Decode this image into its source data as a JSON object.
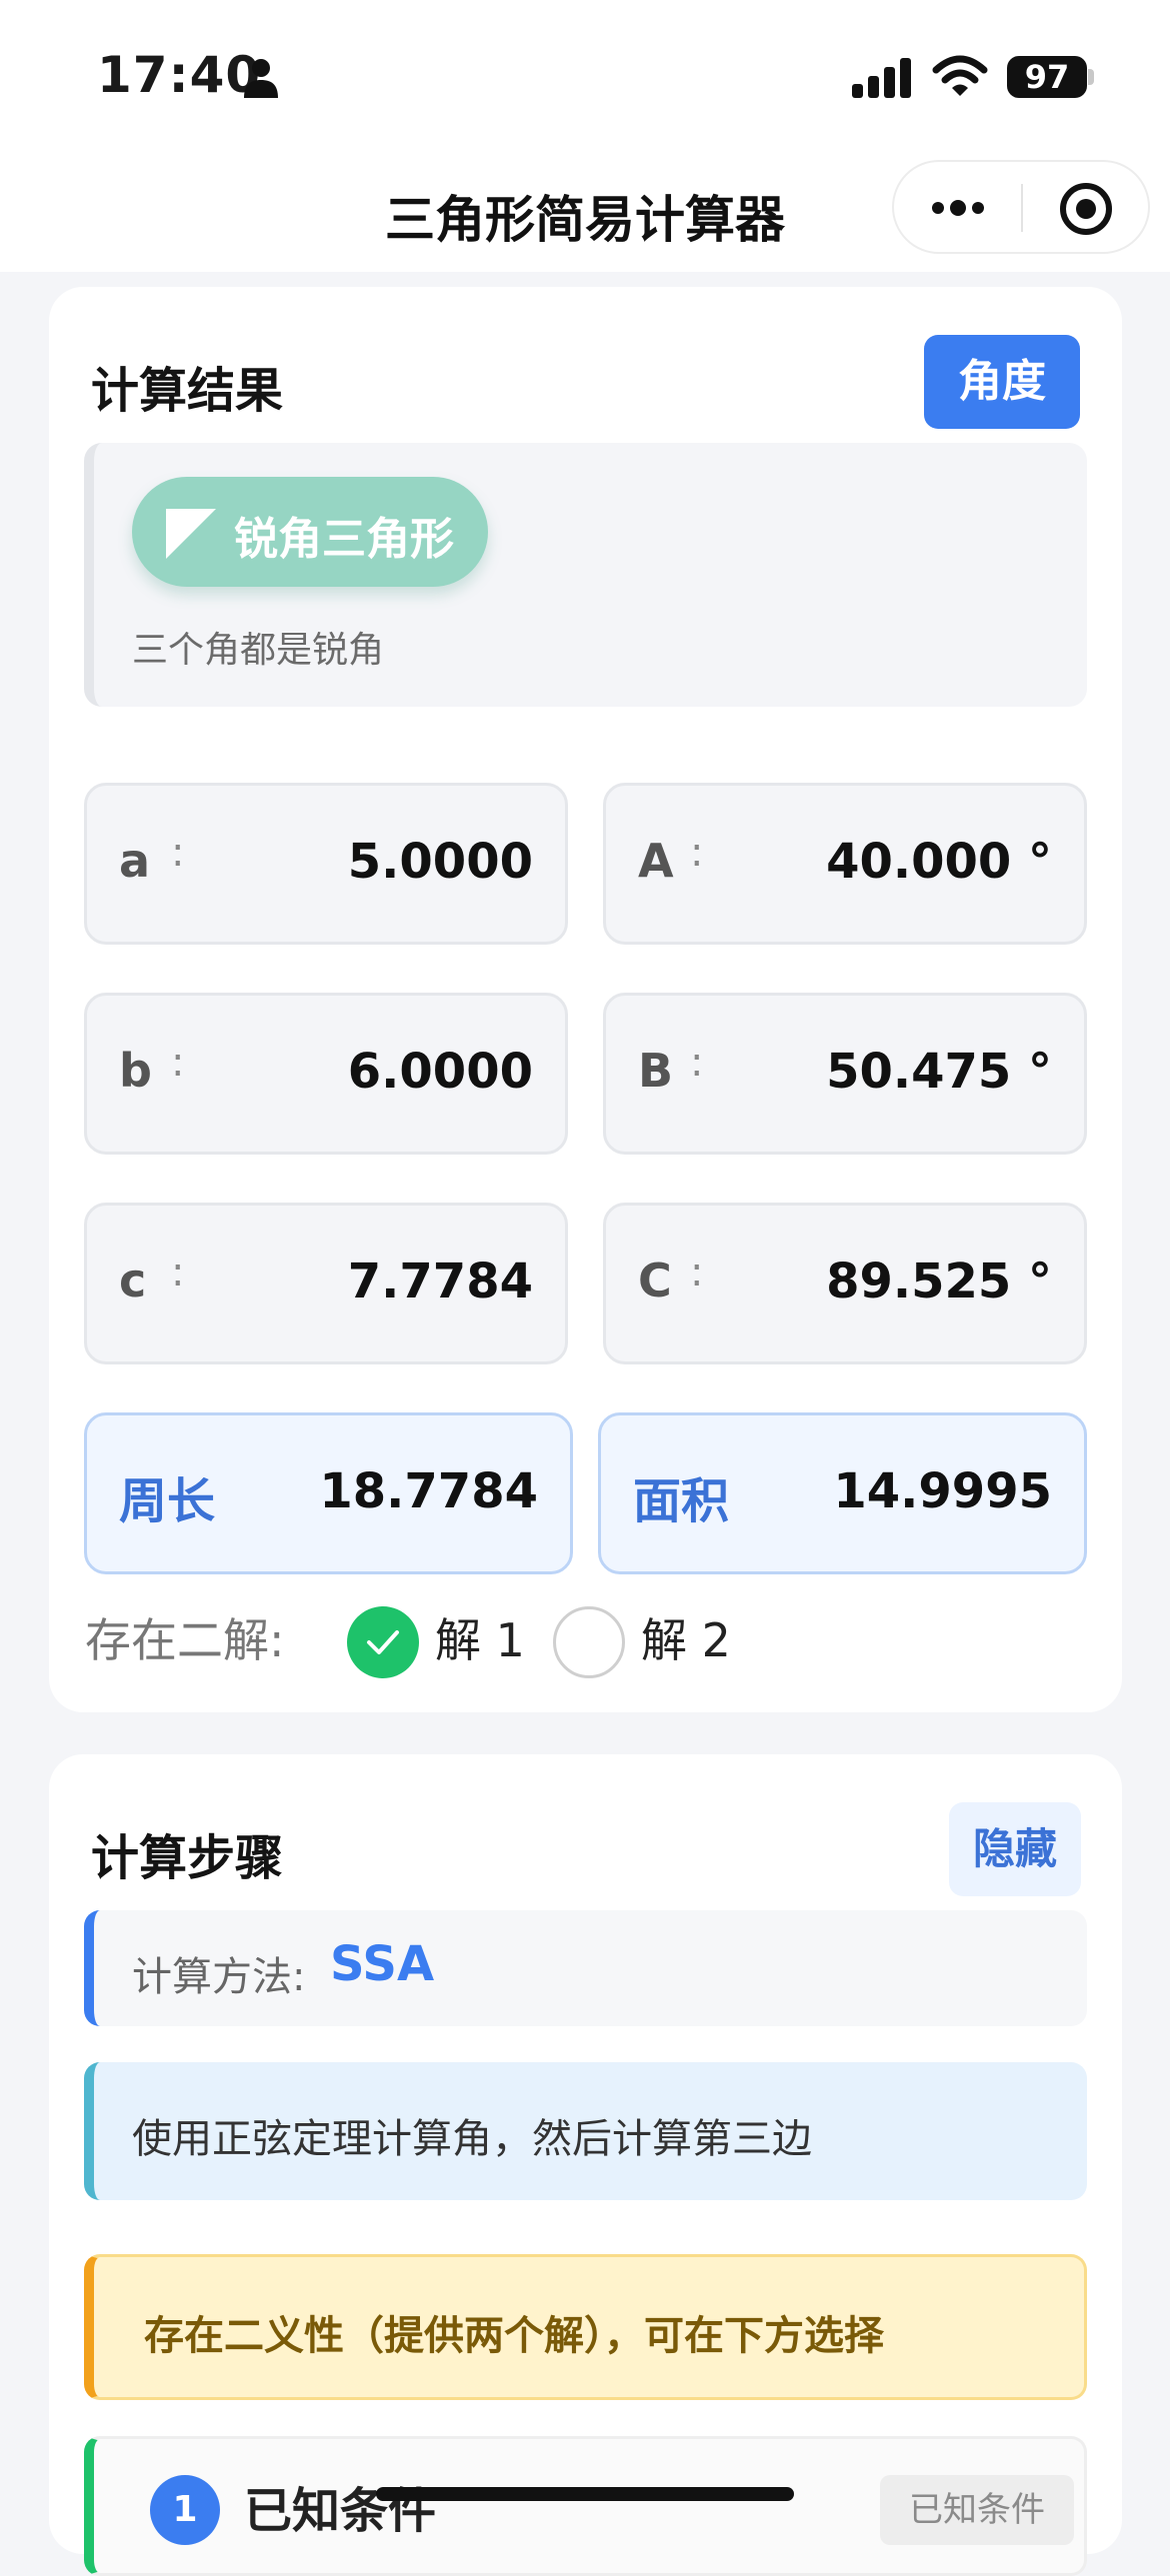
{
  "status_bar": {
    "time": "17:40",
    "battery": "97"
  },
  "nav": {
    "title": "三角形简易计算器"
  },
  "result": {
    "title": "计算结果",
    "angle_button": "角度",
    "triangle_type": "锐角三角形",
    "triangle_desc": "三个角都是锐角",
    "sides": [
      {
        "name": "a",
        "colon": ":",
        "value": "5.0000"
      },
      {
        "name": "b",
        "colon": ":",
        "value": "6.0000"
      },
      {
        "name": "c",
        "colon": ":",
        "value": "7.7784"
      }
    ],
    "angles": [
      {
        "name": "A",
        "colon": ":",
        "value": "40.000 °"
      },
      {
        "name": "B",
        "colon": ":",
        "value": "50.475 °"
      },
      {
        "name": "C",
        "colon": ":",
        "value": "89.525 °"
      }
    ],
    "perimeter_label": "周长",
    "perimeter_value": "18.7784",
    "area_label": "面积",
    "area_value": "14.9995",
    "two_solutions_label": "存在二解:",
    "solution1_label": "解 1",
    "solution2_label": "解 2",
    "selected_solution": 1
  },
  "steps": {
    "title": "计算步骤",
    "hide_button": "隐藏",
    "method_label": "计算方法:",
    "method_value": "SSA",
    "info_note": "使用正弦定理计算角，然后计算第三边",
    "warn_note": "存在二义性（提供两个解），可在下方选择",
    "first_step": {
      "number": "1",
      "title": "已知条件",
      "tag": "已知条件"
    }
  },
  "colors": {
    "accent": "#3b7df0",
    "badge_green": "#96d5c3",
    "radio_selected": "#1ec26a",
    "warn_border": "#f2a11b",
    "info_border": "#4fb6cf"
  }
}
